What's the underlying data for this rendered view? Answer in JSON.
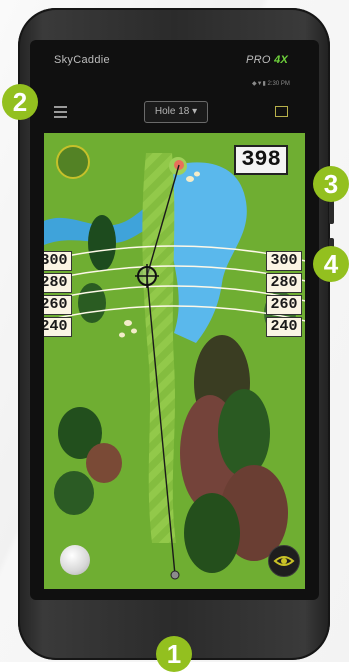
{
  "device": {
    "brand_logo": "SkyCaddie",
    "model_logo": "PRO",
    "model_suffix": "4X",
    "status_bar": "◆▼▮ 2:30 PM"
  },
  "toolbar": {
    "hole_select": "Hole 18",
    "menu_icon": "hamburger-menu-icon",
    "edit_icon": "scorecard-edit-icon"
  },
  "map": {
    "distance_to_green": "398",
    "arc_distances": [
      "300",
      "280",
      "260",
      "240"
    ],
    "accent_color": "#93c01f"
  },
  "callouts": [
    "1",
    "2",
    "3",
    "4"
  ]
}
